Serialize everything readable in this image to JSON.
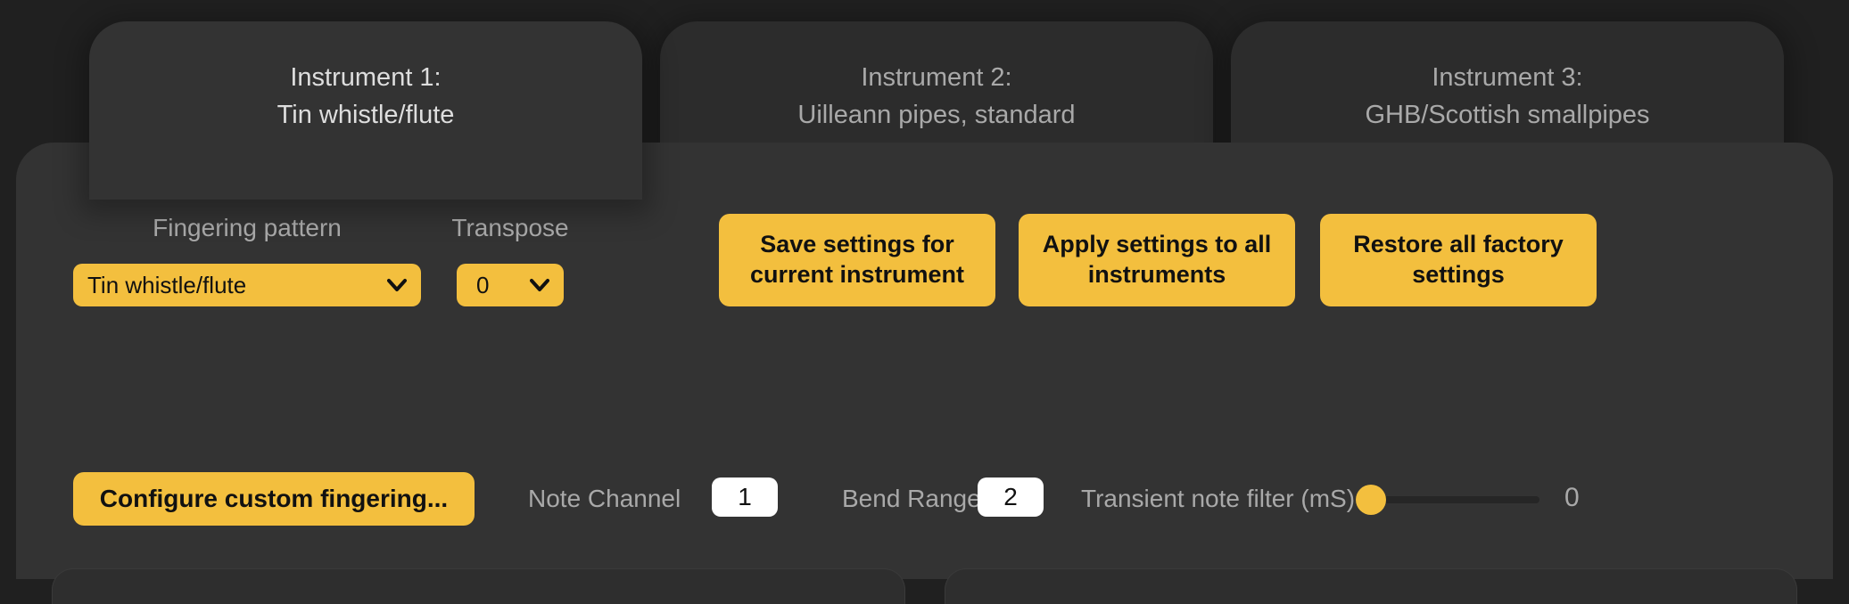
{
  "tabs": [
    {
      "title_line1": "Instrument 1:",
      "title_line2": "Tin whistle/flute",
      "active": true
    },
    {
      "title_line1": "Instrument 2:",
      "title_line2": "Uilleann pipes, standard",
      "active": false
    },
    {
      "title_line1": "Instrument 3:",
      "title_line2": "GHB/Scottish smallpipes",
      "active": false
    }
  ],
  "labels": {
    "fingering_pattern": "Fingering pattern",
    "transpose": "Transpose",
    "note_channel": "Note Channel",
    "bend_range": "Bend Range",
    "transient_filter": "Transient note filter (mS)"
  },
  "selects": {
    "fingering_value": "Tin whistle/flute",
    "transpose_value": "0"
  },
  "buttons": {
    "save": "Save settings for current instrument",
    "apply": "Apply settings to all instruments",
    "restore": "Restore all factory settings",
    "configure": "Configure custom fingering..."
  },
  "inputs": {
    "note_channel": "1",
    "bend_range": "2"
  },
  "slider": {
    "transient_value": "0"
  }
}
